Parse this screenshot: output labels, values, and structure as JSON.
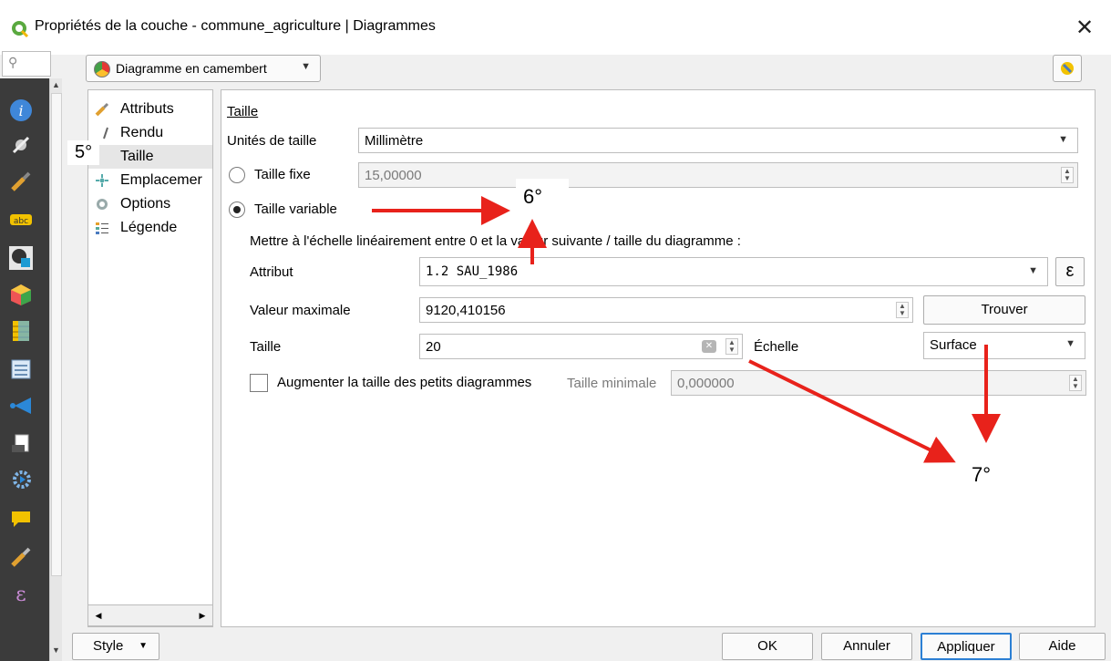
{
  "window": {
    "title": "Propriétés de la couche - commune_agriculture | Diagrammes",
    "close": "✕"
  },
  "diagram_type": {
    "label": "Diagramme en camembert"
  },
  "tree": {
    "items": [
      {
        "label": "Attributs"
      },
      {
        "label": "Rendu"
      },
      {
        "label": "Taille"
      },
      {
        "label": "Emplacemer"
      },
      {
        "label": "Options"
      },
      {
        "label": "Légende"
      }
    ]
  },
  "section_title": "Taille",
  "size_units": {
    "label": "Unités de taille",
    "value": "Millimètre"
  },
  "fixed_size": {
    "label": "Taille fixe",
    "value": "15,00000"
  },
  "variable_size": {
    "label": "Taille variable"
  },
  "scale_description": "Mettre à l'échelle linéairement entre 0 et la valeur suivante / taille du diagramme :",
  "attribute": {
    "label": "Attribut",
    "value": "1.2 SAU_1986",
    "expr_button": "ε"
  },
  "max_value": {
    "label": "Valeur maximale",
    "value": "9120,410156",
    "find_button": "Trouver"
  },
  "size": {
    "label": "Taille",
    "value": "20",
    "scale_label": "Échelle",
    "scale_value": "Surface"
  },
  "increase_small": {
    "label": "Augmenter la taille des petits diagrammes",
    "min_label": "Taille minimale",
    "min_value": "0,000000"
  },
  "footer": {
    "style": "Style",
    "ok": "OK",
    "cancel": "Annuler",
    "apply": "Appliquer",
    "help": "Aide"
  },
  "annotations": {
    "step5": "5°",
    "step6": "6°",
    "step7": "7°"
  },
  "colors": {
    "annotation_arrow": "#e8221b",
    "sidebar_bg": "#3b3b3b",
    "selection": "#e6e6e6"
  }
}
